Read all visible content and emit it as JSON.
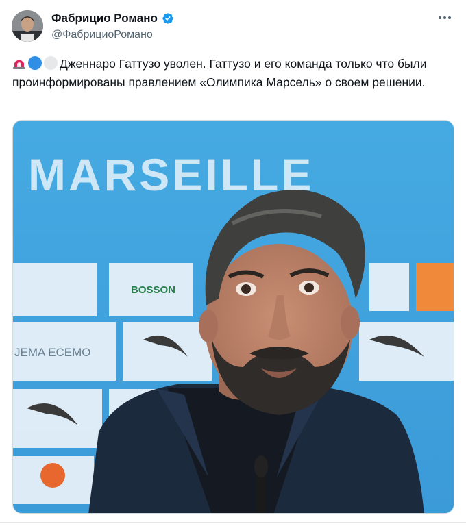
{
  "author": {
    "name": "Фабрицио Романо",
    "handle": "@ФабрициоРомано",
    "verified": true
  },
  "tweet": {
    "emojis": [
      "siren-emoji",
      "blue-circle-emoji",
      "white-circle-emoji"
    ],
    "text": "Дженнаро Гаттузо уволен. Гаттузо и его команда только что были проинформированы правлением «Олимпика Марсель» о своем решении."
  },
  "media": {
    "backdrop_text": "MARSEILLE",
    "sponsor_texts": [
      "BOSSON",
      "JEMA ECEMO"
    ],
    "colors": {
      "backdrop": "#3fa4de",
      "jacket": "#1c2a3e"
    }
  },
  "colors": {
    "verified": "#1d9bf0",
    "text": "#0f1419",
    "secondary": "#536471",
    "blue_circle": "#2f8fe6",
    "white_circle": "#e6e8ea",
    "siren": "#e0245e"
  }
}
